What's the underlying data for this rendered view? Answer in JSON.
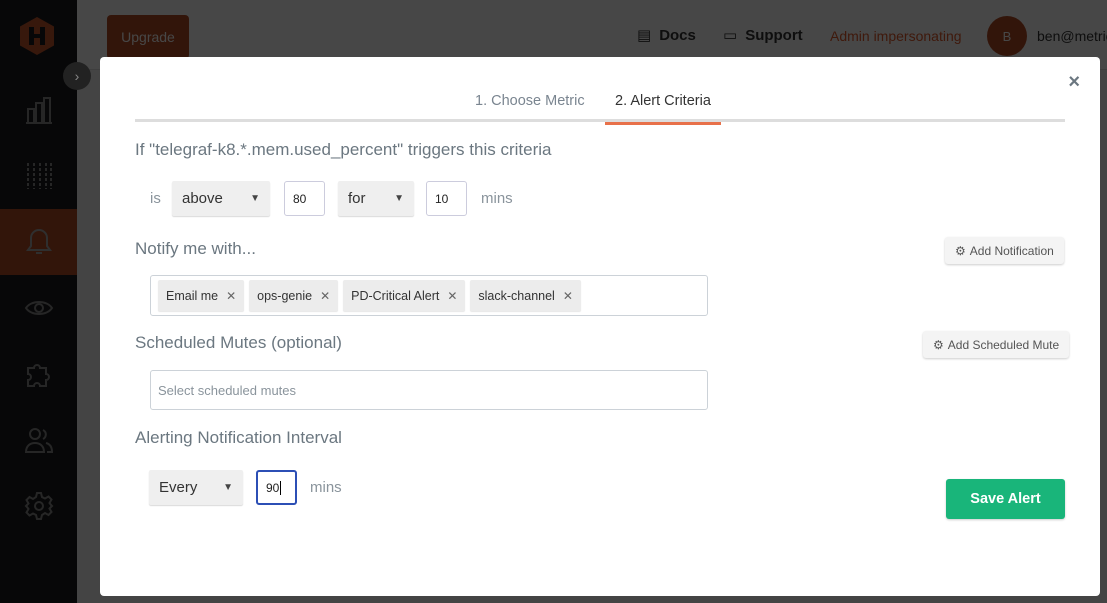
{
  "app": {
    "upgrade_label": "Upgrade",
    "nav": {
      "docs_label": "Docs",
      "support_label": "Support",
      "admin_label": "Admin impersonating",
      "avatar_initial": "B",
      "user_email": "ben@metric"
    },
    "sidebar": {
      "items": [
        {
          "name": "dashboards",
          "icon": "bar-chart-icon"
        },
        {
          "name": "metrics",
          "icon": "metrics-icon"
        },
        {
          "name": "alerts",
          "icon": "bell-icon",
          "active": true
        },
        {
          "name": "views",
          "icon": "eye-icon"
        },
        {
          "name": "integrations",
          "icon": "puzzle-icon"
        },
        {
          "name": "team",
          "icon": "users-icon"
        },
        {
          "name": "settings",
          "icon": "gear-icon"
        }
      ],
      "accent": "#b24b26"
    }
  },
  "modal": {
    "close_label": "×",
    "tabs": [
      {
        "label": "1. Choose Metric",
        "active": false
      },
      {
        "label": "2. Alert Criteria",
        "active": true
      }
    ],
    "criteria": {
      "title": "If \"telegraf-k8.*.mem.used_percent\" triggers this criteria",
      "is_label": "is",
      "comparator": "above",
      "threshold": "80",
      "duration_mode": "for",
      "duration": "10",
      "unit_label": "mins"
    },
    "notify": {
      "title": "Notify me with...",
      "add_button": "Add Notification",
      "tags": [
        "Email me",
        "ops-genie",
        "PD-Critical Alert",
        "slack-channel"
      ],
      "remove_glyph": "✕"
    },
    "mutes": {
      "title": "Scheduled Mutes (optional)",
      "add_button": "Add Scheduled Mute",
      "placeholder": "Select scheduled mutes"
    },
    "interval": {
      "title": "Alerting Notification Interval",
      "mode": "Every",
      "value": "90",
      "unit_label": "mins"
    },
    "save_label": "Save Alert",
    "colors": {
      "tab_accent": "#e8714a",
      "save": "#19b57a",
      "focus": "#2c4fb5"
    }
  }
}
